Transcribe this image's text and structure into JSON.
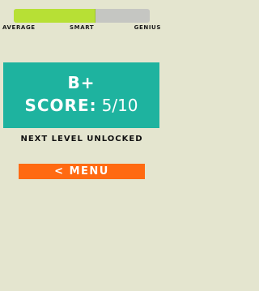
{
  "progress": {
    "fraction": 0.6,
    "fill_color": "#b7e035",
    "track_color": "#c5c6c2",
    "labels": {
      "left": "Average",
      "middle": "Smart",
      "right": "Genius"
    }
  },
  "result": {
    "panel_color": "#1eb39f",
    "grade": "B+",
    "score_label": "Score:",
    "score_value": "5/10"
  },
  "message": "Next level unlocked",
  "menu_button": {
    "icon": "chevron-left-icon",
    "chevron": "<",
    "label": "Menu",
    "color": "#ff6a12"
  }
}
